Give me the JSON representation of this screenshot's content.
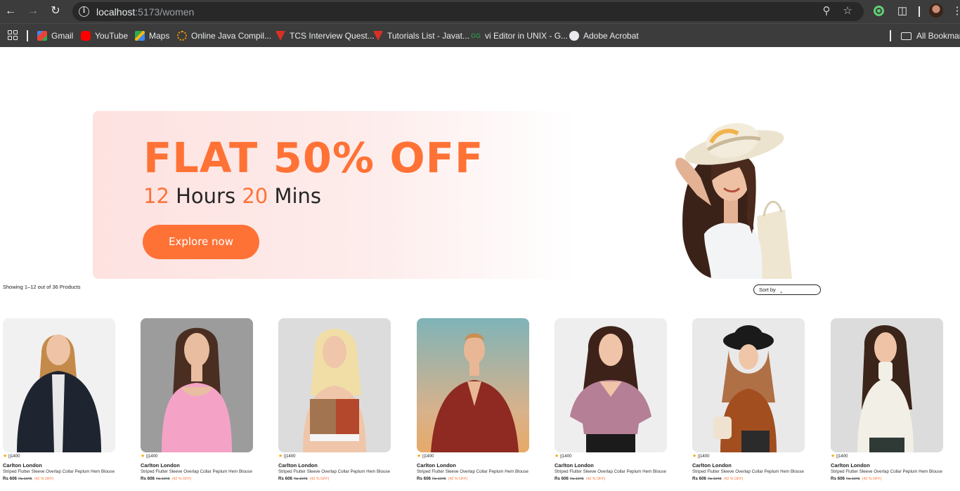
{
  "browser": {
    "url_host": "localhost",
    "url_rest": ":5173/women",
    "bookmarks": [
      {
        "label": "Gmail",
        "icon": "gmail-icon",
        "color": "#ea4335"
      },
      {
        "label": "YouTube",
        "icon": "youtube-icon",
        "color": "#ff0000"
      },
      {
        "label": "Maps",
        "icon": "maps-icon",
        "color": "#34a853"
      },
      {
        "label": "Online Java Compil...",
        "icon": "compiler-icon",
        "color": "#f29900"
      },
      {
        "label": "TCS Interview Quest...",
        "icon": "shield-icon",
        "color": "#d93025"
      },
      {
        "label": "Tutorials List - Javat...",
        "icon": "shield-icon",
        "color": "#d93025"
      },
      {
        "label": "vi Editor in UNIX - G...",
        "icon": "gfg-icon",
        "color": "#2f8d46"
      },
      {
        "label": "Adobe Acrobat",
        "icon": "globe-icon",
        "color": "#e8eaed"
      }
    ],
    "all_bookmarks": "All Bookmarks"
  },
  "hero": {
    "title": "FLAT 50% OFF",
    "hours": "12",
    "hours_label": "Hours",
    "mins": "20",
    "mins_label": "Mins",
    "cta": "Explore now",
    "accent": "#ff7236"
  },
  "listing": {
    "count_text": "Showing 1–12 out of 36 Products",
    "sort_label": "Sort by"
  },
  "products": [
    {
      "rating": "||1400",
      "brand": "Carlton London",
      "name": "Striped Flutter Sleeve Overlap Collar Peplum Hem Blouse",
      "price": "Rs 606",
      "mrp": "Rs 1045",
      "discount": "(42 % OFF)",
      "photo": "model-black-fur-jacket"
    },
    {
      "rating": "||1400",
      "brand": "Carlton London",
      "name": "Striped Flutter Sleeve Overlap Collar Peplum Hem Blouse",
      "price": "Rs 606",
      "mrp": "Rs 1045",
      "discount": "(42 % OFF)",
      "photo": "model-pink-top"
    },
    {
      "rating": "||1400",
      "brand": "Carlton London",
      "name": "Striped Flutter Sleeve Overlap Collar Peplum Hem Blouse",
      "price": "Rs 606",
      "mrp": "Rs 1045",
      "discount": "(42 % OFF)",
      "photo": "model-sports-bra"
    },
    {
      "rating": "||1400",
      "brand": "Carlton London",
      "name": "Striped Flutter Sleeve Overlap Collar Peplum Hem Blouse",
      "price": "Rs 606",
      "mrp": "Rs 1045",
      "discount": "(42 % OFF)",
      "photo": "model-red-check-wrap"
    },
    {
      "rating": "||1400",
      "brand": "Carlton London",
      "name": "Striped Flutter Sleeve Overlap Collar Peplum Hem Blouse",
      "price": "Rs 606",
      "mrp": "Rs 1045",
      "discount": "(42 % OFF)",
      "photo": "model-mauve-blouse"
    },
    {
      "rating": "||1400",
      "brand": "Carlton London",
      "name": "Striped Flutter Sleeve Overlap Collar Peplum Hem Blouse",
      "price": "Rs 606",
      "mrp": "Rs 1045",
      "discount": "(42 % OFF)",
      "photo": "model-hijab-rust-top"
    },
    {
      "rating": "||1400",
      "brand": "Carlton London",
      "name": "Striped Flutter Sleeve Overlap Collar Peplum Hem Blouse",
      "price": "Rs 606",
      "mrp": "Rs 1045",
      "discount": "(42 % OFF)",
      "photo": "model-white-turtleneck"
    }
  ]
}
